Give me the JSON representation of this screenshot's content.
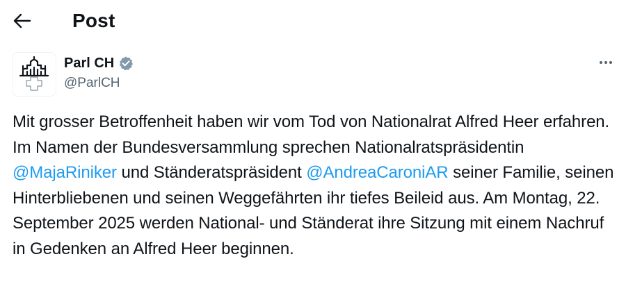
{
  "header": {
    "back_icon": "arrow-left-icon",
    "title": "Post"
  },
  "author": {
    "avatar_icon": "parliament-building-swiss-cross-icon",
    "name": "Parl CH",
    "verified_icon": "verified-badge-icon",
    "verified_color": "#829aab",
    "handle": "@ParlCH",
    "more_icon": "more-horizontal-icon"
  },
  "post": {
    "text_1": "Mit grosser Betroffenheit haben wir vom Tod von Nationalrat Alfred Heer erfahren. Im Namen der Bundesversammlung sprechen Nationalratspräsidentin ",
    "mention_1": "@MajaRiniker",
    "text_2": " und Ständeratspräsident ",
    "mention_2": "@AndreaCaroniAR",
    "text_3": " seiner Familie, seinen Hinterbliebenen und seinen Weggefährten ihr tiefes Beileid aus. Am Montag, 22. September 2025 werden National- und Ständerat ihre Sitzung mit einem Nachruf in Gedenken an Alfred Heer beginnen.",
    "mention_color": "#1d9bf0"
  }
}
